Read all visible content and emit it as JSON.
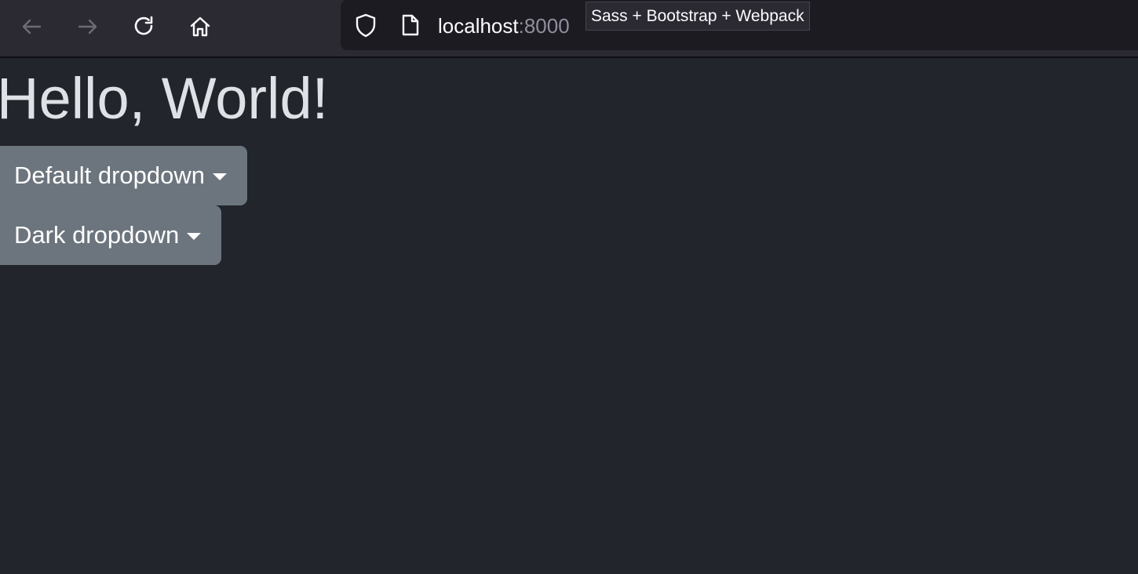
{
  "browser": {
    "url_host": "localhost",
    "url_port": ":8000",
    "tooltip": "Sass + Bootstrap + Webpack",
    "icons": {
      "back": "arrow-left-icon",
      "forward": "arrow-right-icon",
      "reload": "reload-icon",
      "home": "home-icon",
      "tracking": "shield-icon",
      "page": "document-icon"
    }
  },
  "page": {
    "heading": "Hello, World!",
    "dropdowns": [
      {
        "label": "Default dropdown"
      },
      {
        "label": "Dark dropdown"
      }
    ]
  },
  "colors": {
    "page_background": "#22252b",
    "toolbar_background": "#2b2a33",
    "heading_text": "#dee2e6",
    "dropdown_background": "#6c757d"
  }
}
